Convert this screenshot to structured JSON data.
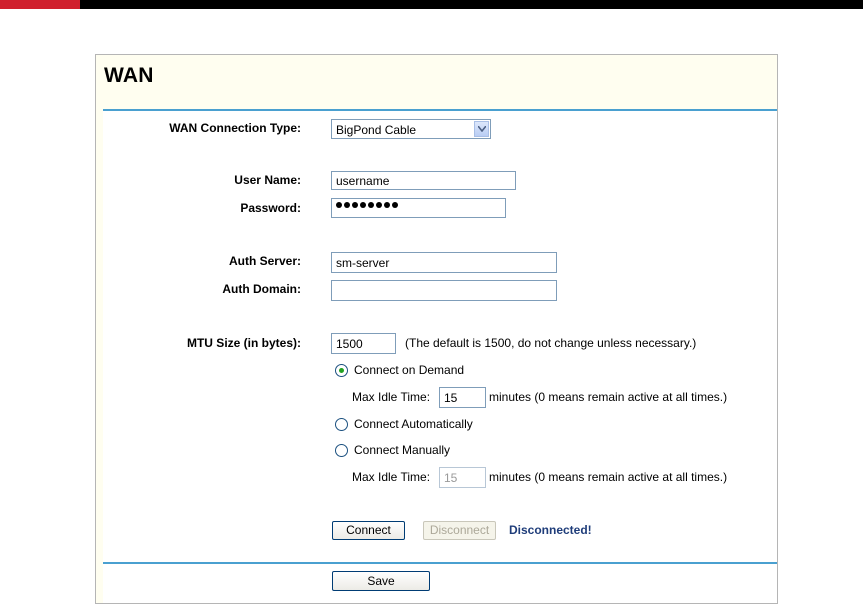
{
  "page": {
    "title": "WAN",
    "accent_color": "#d0202e",
    "rule_color": "#4aa0d0"
  },
  "wan": {
    "connection_type_label": "WAN Connection Type:",
    "connection_type_value": "BigPond Cable",
    "user_name_label": "User Name:",
    "user_name_value": "username",
    "password_label": "Password:",
    "password_length": 8,
    "auth_server_label": "Auth Server:",
    "auth_server_value": "sm-server",
    "auth_domain_label": "Auth Domain:",
    "auth_domain_value": "",
    "mtu_label": "MTU Size (in bytes):",
    "mtu_value": "1500",
    "mtu_note": "(The default is 1500, do not change unless necessary.)"
  },
  "mode": {
    "on_demand_label": "Connect on Demand",
    "on_demand_checked": true,
    "max_idle_label": "Max Idle Time:",
    "max_idle_value": "15",
    "max_idle_note": "minutes (0 means remain active at all times.)",
    "automatic_label": "Connect Automatically",
    "manual_label": "Connect Manually",
    "manual_max_idle_label": "Max Idle Time:",
    "manual_max_idle_value": "15",
    "manual_max_idle_note": "minutes (0 means remain active at all times.)"
  },
  "actions": {
    "connect_label": "Connect",
    "disconnect_label": "Disconnect",
    "status": "Disconnected!",
    "save_label": "Save"
  }
}
